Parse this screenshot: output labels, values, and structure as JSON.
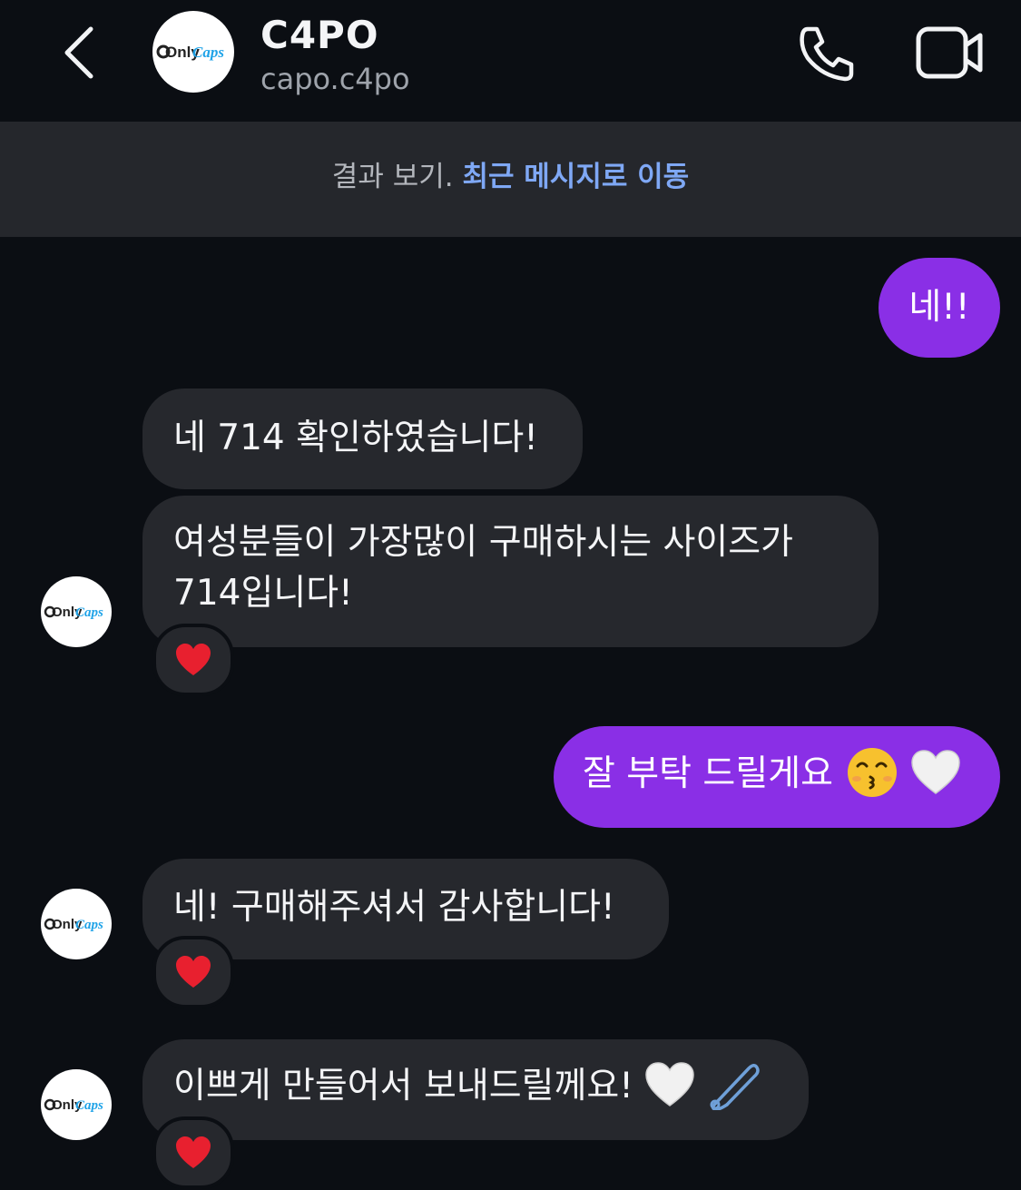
{
  "header": {
    "title": "C4PO",
    "username": "capo.c4po",
    "avatar_logo_prefix": "Only",
    "avatar_logo_suffix": "Caps",
    "icons": [
      "back-chevron-icon",
      "phone-icon",
      "video-camera-icon"
    ]
  },
  "banner": {
    "muted_text": "결과 보기.",
    "link_text": "최근 메시지로 이동"
  },
  "messages": [
    {
      "direction": "out",
      "text": "네!!"
    },
    {
      "direction": "in",
      "text": "네 714 확인하였습니다!"
    },
    {
      "direction": "in",
      "line1": "여성분들이 가장많이 구매하시는 사이즈가",
      "line2": "714입니다!",
      "reaction": "heart"
    },
    {
      "direction": "out",
      "text": "잘 부탁 드릴게요",
      "emojis": [
        "kissing-face-icon",
        "white-heart-icon"
      ]
    },
    {
      "direction": "in",
      "text": "네! 구매해주셔서 감사합니다!",
      "reaction": "heart"
    },
    {
      "direction": "in",
      "text": "이쁘게 만들어서 보내드릴께요!",
      "emojis": [
        "white-heart-icon",
        "safety-pin-icon"
      ],
      "reaction": "heart"
    }
  ],
  "colors": {
    "background": "#0b0e13",
    "incoming_bubble": "#26282d",
    "outgoing_bubble": "#8a2fe6",
    "banner_bg": "#25272c",
    "link": "#7fa8f5",
    "reaction_heart": "#e8202f"
  }
}
